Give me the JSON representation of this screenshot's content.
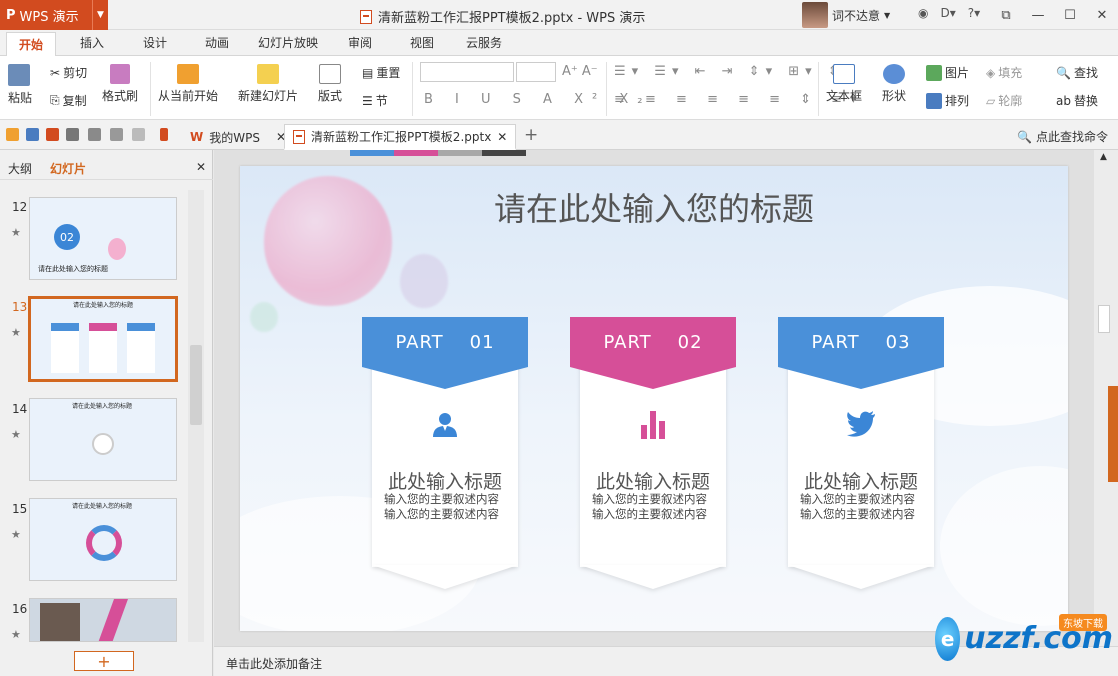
{
  "app": {
    "name": "WPS 演示",
    "logo_letter": "P"
  },
  "window": {
    "title": "清新蓝粉工作汇报PPT模板2.pptx - WPS 演示"
  },
  "user": {
    "name": "词不达意"
  },
  "menu": {
    "tabs": [
      "开始",
      "插入",
      "设计",
      "动画",
      "幻灯片放映",
      "审阅",
      "视图",
      "云服务"
    ],
    "active": "开始"
  },
  "ribbon": {
    "paste": "粘贴",
    "cut": "剪切",
    "copy": "复制",
    "format_painter": "格式刷",
    "from_current": "从当前开始",
    "new_slide": "新建幻灯片",
    "layout": "版式",
    "reset": "重置",
    "section": "节",
    "textbox": "文本框",
    "shape": "形状",
    "picture": "图片",
    "arrange": "排列",
    "fill": "填充",
    "outline": "轮廓",
    "find": "查找",
    "replace": "替换"
  },
  "quickbar": {
    "tabs": [
      {
        "label": "我的WPS"
      },
      {
        "label": "清新蓝粉工作汇报PPT模板2.pptx"
      }
    ],
    "search_cmd": "点此查找命令"
  },
  "panel": {
    "tab_outline": "大纲",
    "tab_slides": "幻灯片",
    "add": "+"
  },
  "thumbnails": [
    {
      "num": "12",
      "caption": "请在此处输入您的标题",
      "badge": "02"
    },
    {
      "num": "13",
      "caption": "请在此处输入您的标题"
    },
    {
      "num": "14",
      "caption": "请在此处输入您的标题"
    },
    {
      "num": "15",
      "caption": "请在此处输入您的标题"
    },
    {
      "num": "16",
      "caption": ""
    }
  ],
  "slide": {
    "title": "请在此处输入您的标题",
    "cards": [
      {
        "part": "PART",
        "num": "01",
        "color": "#4a90d9",
        "dark": "#2f6fb5",
        "icon": "user-icon",
        "title": "此处输入标题",
        "desc1": "输入您的主要叙述内容",
        "desc2": "输入您的主要叙述内容"
      },
      {
        "part": "PART",
        "num": "02",
        "color": "#d64f98",
        "dark": "#a83673",
        "icon": "bar-chart-icon",
        "title": "此处输入标题",
        "desc1": "输入您的主要叙述内容",
        "desc2": "输入您的主要叙述内容"
      },
      {
        "part": "PART",
        "num": "03",
        "color": "#4a90d9",
        "dark": "#2f6fb5",
        "icon": "bird-icon",
        "title": "此处输入标题",
        "desc1": "输入您的主要叙述内容",
        "desc2": "输入您的主要叙述内容"
      }
    ]
  },
  "notes": {
    "placeholder": "单击此处添加备注"
  },
  "watermark": {
    "text": "uzzf.com",
    "badge": "东坡下载"
  }
}
